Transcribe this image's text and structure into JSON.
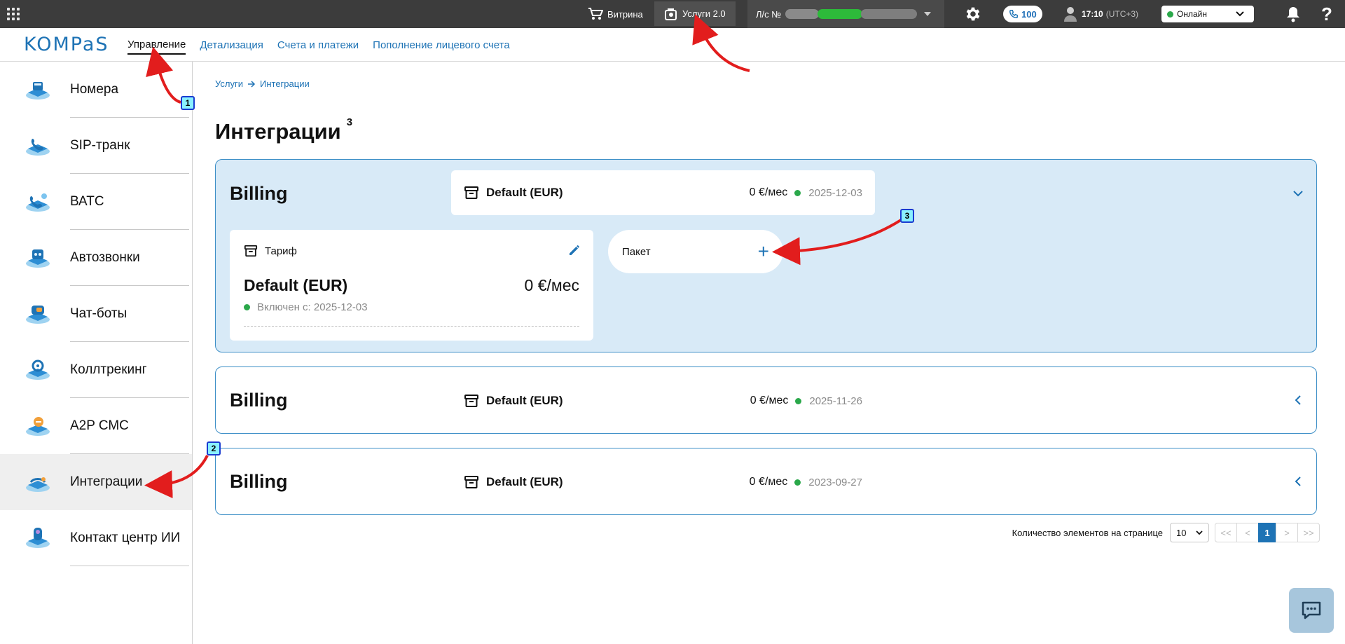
{
  "topbar": {
    "showcase": "Витрина",
    "services": "Услуги 2.0",
    "account_label": "Л/с №",
    "calls_count": "100",
    "time": "17:10",
    "timezone": "(UTC+3)",
    "status": "Онлайн",
    "help": "?"
  },
  "nav": {
    "logo": "KOMPaS",
    "links": [
      "Управление",
      "Детализация",
      "Счета и платежи",
      "Пополнение лицевого счета"
    ]
  },
  "sidebar": {
    "items": [
      {
        "label": "Номера"
      },
      {
        "label": "SIP-транк"
      },
      {
        "label": "ВАТС"
      },
      {
        "label": "Автозвонки"
      },
      {
        "label": "Чат-боты"
      },
      {
        "label": "Коллтрекинг"
      },
      {
        "label": "A2P СМС"
      },
      {
        "label": "Интеграции"
      },
      {
        "label": "Контакт центр ИИ"
      }
    ]
  },
  "breadcrumb": {
    "root": "Услуги",
    "current": "Интеграции"
  },
  "page": {
    "title": "Интеграции",
    "title_mark": "3"
  },
  "cards": [
    {
      "name": "Billing",
      "tariff": "Default (EUR)",
      "price": "0 €/мес",
      "date": "2025-12-03"
    },
    {
      "name": "Billing",
      "tariff": "Default (EUR)",
      "price": "0 €/мес",
      "date": "2025-11-26"
    },
    {
      "name": "Billing",
      "tariff": "Default (EUR)",
      "price": "0 €/мес",
      "date": "2023-09-27"
    }
  ],
  "expanded": {
    "tariff_label": "Тариф",
    "tariff_name": "Default (EUR)",
    "tariff_price": "0 €/мес",
    "since_label": "Включен с: 2025-12-03",
    "package_label": "Пакет",
    "package_add": "+"
  },
  "pagination": {
    "per_page_label": "Количество элементов на странице",
    "per_page": "10",
    "first": "<<",
    "prev": "<",
    "current": "1",
    "next": ">",
    "last": ">>"
  },
  "annotations": [
    "1",
    "2",
    "3"
  ],
  "colors": {
    "accent": "#1e73b5",
    "topbar": "#3c3c3c",
    "expanded_card": "#d8eaf7",
    "online": "#2aa84a",
    "annotation_arrow": "#e21d1d"
  }
}
